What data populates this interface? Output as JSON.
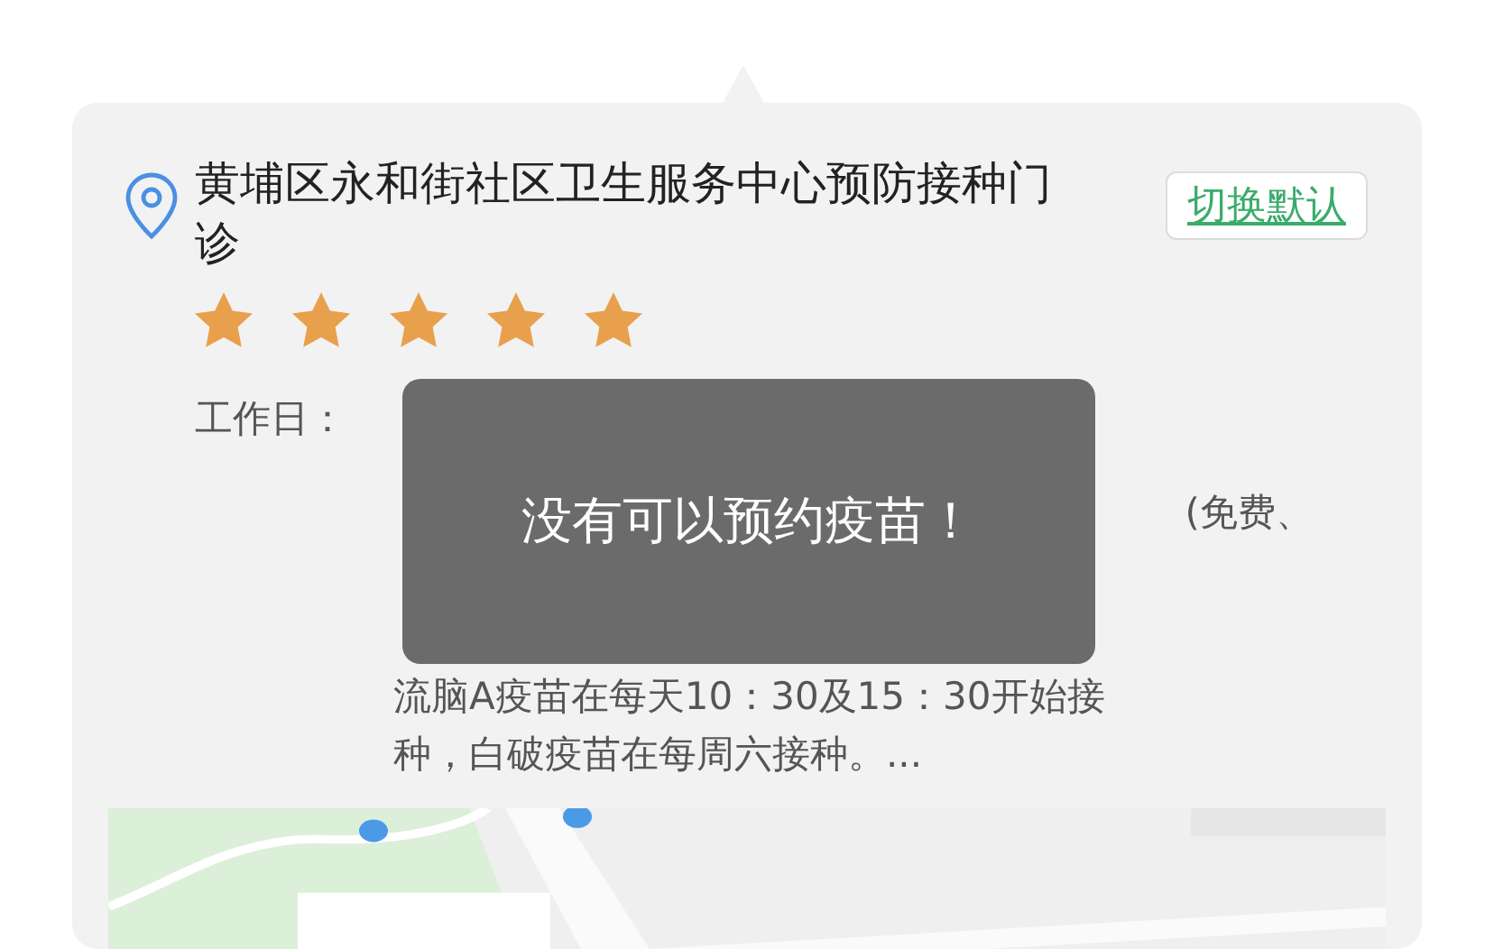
{
  "location": {
    "name": "黄埔区永和街社区卫生服务中心预防接种门诊",
    "stars": 5
  },
  "switch_button": {
    "label": "切换默认"
  },
  "work_days": {
    "label": "工作日：",
    "line_2_fragment": "(免费、",
    "lines": [
      "流脑A疫苗在每天10：30及15：30开始接",
      "种，白破疫苗在每周六接种。..."
    ]
  },
  "toast": {
    "message": "没有可以预约疫苗！"
  }
}
